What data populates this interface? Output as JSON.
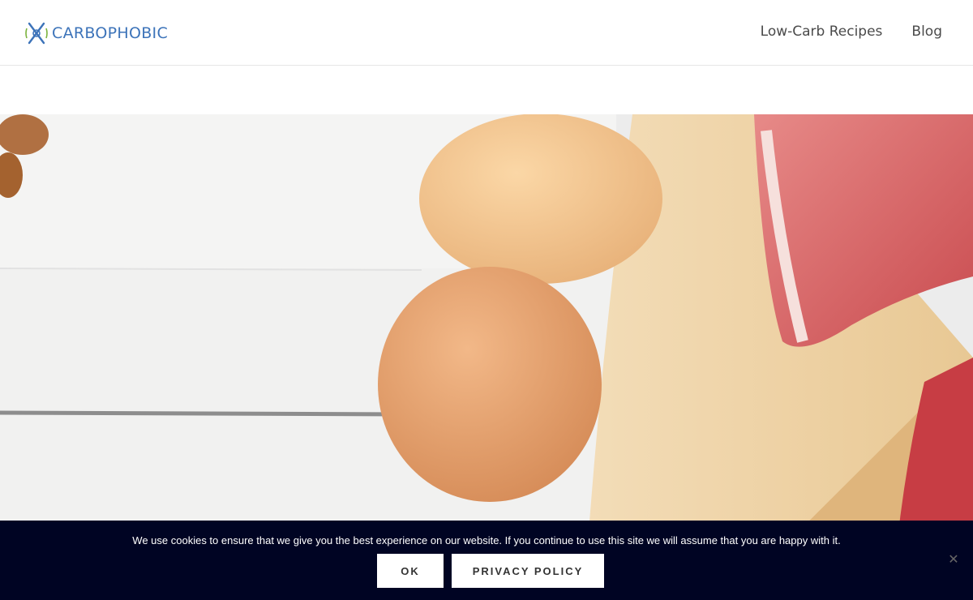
{
  "header": {
    "logo_text": "CARBOPHOBIC",
    "nav": [
      {
        "label": "Low-Carb Recipes"
      },
      {
        "label": "Blog"
      }
    ]
  },
  "hero": {
    "image_icon": "food-photo"
  },
  "cookie_bar": {
    "message": "We use cookies to ensure that we give you the best experience on our website. If you continue to use this site we will assume that you are happy with it.",
    "ok_label": "OK",
    "privacy_label": "PRIVACY POLICY",
    "close_icon": "close-icon"
  },
  "colors": {
    "brand": "#3c73b9",
    "cookie_bg": "#000423"
  }
}
